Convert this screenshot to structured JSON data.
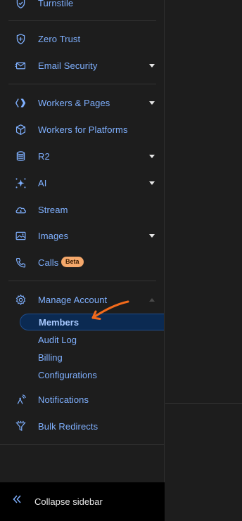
{
  "sidebar": {
    "items": {
      "turnstile": "Turnstile",
      "zero_trust": "Zero Trust",
      "email_security": "Email Security",
      "workers_pages": "Workers & Pages",
      "workers_platforms": "Workers for Platforms",
      "r2": "R2",
      "ai": "AI",
      "stream": "Stream",
      "images": "Images",
      "calls": "Calls",
      "calls_badge": "Beta",
      "manage_account": "Manage Account",
      "notifications": "Notifications",
      "bulk_redirects": "Bulk Redirects"
    },
    "manage_account_subitems": [
      "Members",
      "Audit Log",
      "Billing",
      "Configurations"
    ],
    "active_subitem": "Members",
    "collapse_label": "Collapse sidebar"
  },
  "colors": {
    "link": "#7fb0ff",
    "active_bg": "#0b2a52",
    "badge_bg": "#f5a86b",
    "annotation_arrow": "#f26a1b"
  },
  "icons": {
    "turnstile": "check-shield-icon",
    "zero_trust": "lock-shield-icon",
    "email_security": "envelope-icon",
    "workers_pages": "workers-icon",
    "workers_platforms": "cube-icon",
    "r2": "database-icon",
    "ai": "sparkle-icon",
    "stream": "cloud-play-icon",
    "images": "image-icon",
    "calls": "phone-icon",
    "manage_account": "gear-icon",
    "notifications": "antenna-icon",
    "bulk_redirects": "funnel-icon",
    "collapse": "double-chevron-left-icon"
  }
}
